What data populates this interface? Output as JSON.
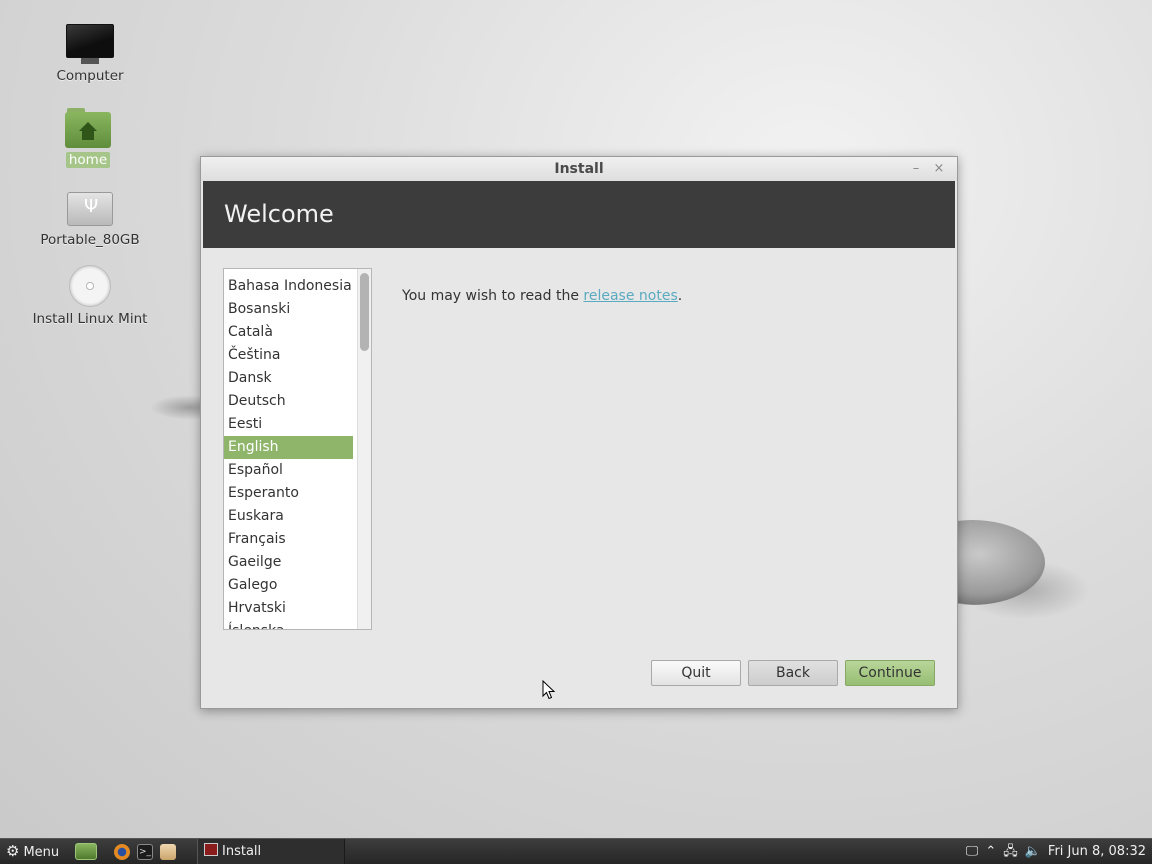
{
  "desktop": {
    "icons": [
      {
        "label": "Computer",
        "icon": "monitor-icon"
      },
      {
        "label": "home",
        "icon": "home-folder-icon",
        "selected": true
      },
      {
        "label": "Portable_80GB",
        "icon": "usb-drive-icon"
      },
      {
        "label": "Install Linux Mint",
        "icon": "optical-disc-icon"
      }
    ]
  },
  "window": {
    "title": "Install",
    "minimize_glyph": "–",
    "close_glyph": "×",
    "banner_title": "Welcome",
    "languages": [
      "Bahasa Indonesia",
      "Bosanski",
      "Català",
      "Čeština",
      "Dansk",
      "Deutsch",
      "Eesti",
      "English",
      "Español",
      "Esperanto",
      "Euskara",
      "Français",
      "Gaeilge",
      "Galego",
      "Hrvatski",
      "Íslenska"
    ],
    "selected_language": "English",
    "notes_prefix": "You may wish to read the ",
    "notes_link": "release notes",
    "notes_suffix": ".",
    "buttons": {
      "quit": "Quit",
      "back": "Back",
      "continue": "Continue"
    }
  },
  "taskbar": {
    "menu_label": "Menu",
    "menu_icon": "gear-icon",
    "launchers": [
      "show-desktop-icon",
      "firefox-icon",
      "terminal-icon",
      "files-icon"
    ],
    "terminal_glyph": ">_",
    "task_label": "Install",
    "clock": "Fri Jun  8, 08:32",
    "tray_icons": [
      "display-icon",
      "chevron-up-icon",
      "network-icon",
      "volume-icon"
    ]
  },
  "colors": {
    "accent_green": "#8fb56b",
    "banner_bg": "#3c3c3c",
    "link": "#5aaac0"
  }
}
